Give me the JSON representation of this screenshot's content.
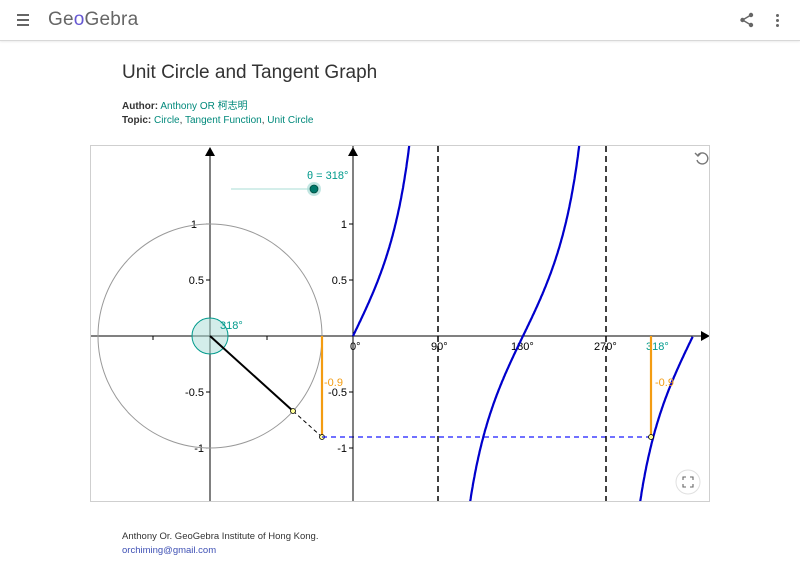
{
  "header": {
    "logo_pre": "Ge",
    "logo_o": "o",
    "logo_post": "Gebra",
    "menu_icon": "hamburger-menu-icon",
    "share_icon": "share-icon",
    "more_icon": "more-vert-icon"
  },
  "page": {
    "title": "Unit Circle and Tangent Graph",
    "author_label": "Author:",
    "author_name": "Anthony OR 柯志明",
    "topic_label": "Topic:",
    "topics": [
      "Circle",
      "Tangent Function",
      "Unit Circle"
    ],
    "topic_sep": ", "
  },
  "applet": {
    "slider_label": "θ = 318°",
    "angle_label": "318°",
    "left_ticks": [
      "1",
      "0.5",
      "-0.5",
      "-1"
    ],
    "right_yticks": [
      "1",
      "0.5",
      "-0.5",
      "-1"
    ],
    "right_xticks": [
      "0°",
      "90°",
      "180°",
      "270°"
    ],
    "theta_xlabel": "318°",
    "tan_value_left": "-0.9",
    "tan_value_right": "-0.9",
    "theta_deg": 318,
    "colors": {
      "curve": "#0000cc",
      "accent": "#009a8c",
      "tan": "#f39c12",
      "dash": "#1a1aff"
    },
    "reset_icon": "refresh-icon",
    "fullscreen_icon": "fullscreen-icon"
  },
  "footer": {
    "text": "Anthony Or.  GeoGebra Institute of Hong Kong.",
    "email": "orchiming@gmail.com"
  }
}
